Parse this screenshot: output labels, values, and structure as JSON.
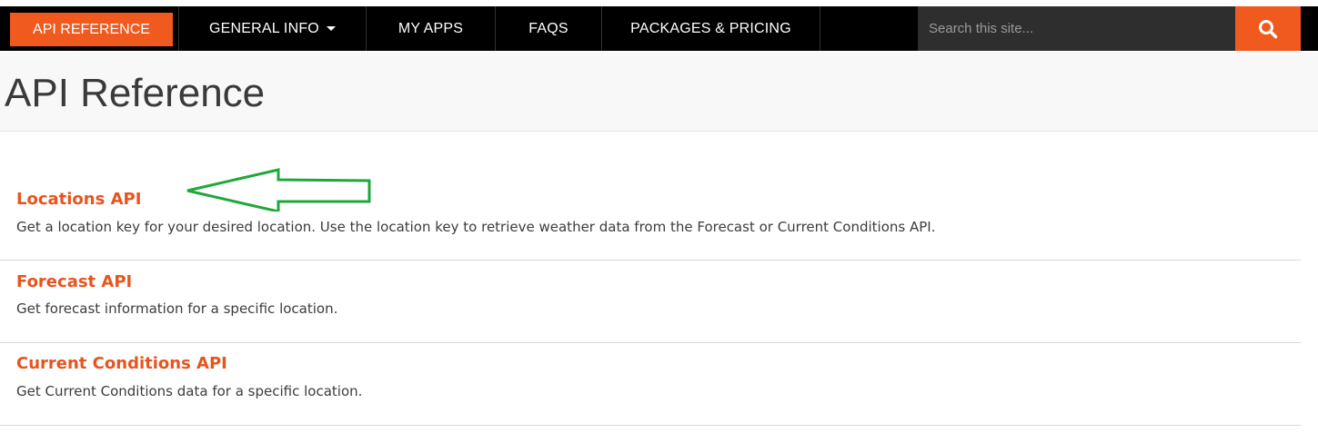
{
  "nav": {
    "items": [
      {
        "label": "API REFERENCE",
        "active": true
      },
      {
        "label": "GENERAL INFO",
        "dropdown": true
      },
      {
        "label": "MY APPS"
      },
      {
        "label": "FAQS"
      },
      {
        "label": "PACKAGES & PRICING"
      }
    ],
    "search_placeholder": "Search this site...",
    "search_icon": "search-icon"
  },
  "page": {
    "title": "API Reference"
  },
  "apis": [
    {
      "title": "Locations API",
      "description": "Get a location key for your desired location. Use the location key to retrieve weather data from the Forecast or Current Conditions API."
    },
    {
      "title": "Forecast API",
      "description": "Get forecast information for a specific location."
    },
    {
      "title": "Current Conditions API",
      "description": "Get Current Conditions data for a specific location."
    }
  ],
  "annotation": {
    "icon": "arrow-left-icon",
    "color": "#1fa83a"
  },
  "colors": {
    "accent": "#f05a1e",
    "link": "#e8541e",
    "nav_bg": "#000000",
    "search_bg": "#2e2e2e"
  }
}
